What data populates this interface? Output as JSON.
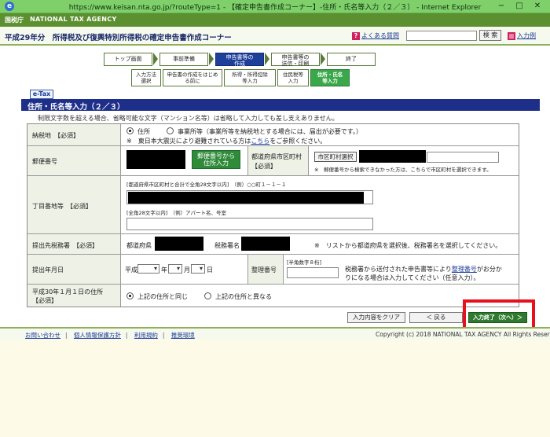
{
  "window": {
    "title": "https://www.keisan.nta.go.jp/?routeType=1 - 【確定申告書作成コーナー】-住所・氏名等入力（２／３） - Internet Explorer",
    "min": "−",
    "max": "□",
    "close": "✕"
  },
  "agency": {
    "logo": "国税庁",
    "name": "NATIONAL TAX AGENCY"
  },
  "header": {
    "page_title": "平成29年分　所得税及び復興特別所得税の確定申告書作成コーナー",
    "faq": "よくある質問",
    "search_button": "検 索",
    "example": "入力例"
  },
  "steps": {
    "main": [
      "トップ画面",
      "事前準備",
      "申告書等の",
      "作成",
      "申告書等の",
      "送信・印刷",
      "終了"
    ],
    "sub": [
      "入力方法",
      "選択",
      "申告書の作成をはじめ",
      "る前に",
      "所得・所得控除",
      "等入力",
      "住民税等",
      "入力",
      "住所・氏名",
      "等入力"
    ]
  },
  "etax_label": "e-Tax",
  "section_title": "住所・氏名等入力（２／３）",
  "note": "制限文字数を超える場合、省略可能な文字（マンション名等）は省略して入力しても差し支えありません。",
  "form": {
    "tax_place": {
      "label": "納税地",
      "required": "【必須】",
      "opt_address": "住所",
      "opt_office": "事業所等（事業所等を納税地とする場合には、届出が必要です。）",
      "disaster_note_a": "※　東日本大震災により避難されている方は",
      "disaster_link": "こちら",
      "disaster_note_b": "をご参照ください。"
    },
    "postal": {
      "label": "郵便番号",
      "convert_btn_1": "郵便番号から",
      "convert_btn_2": "住所入力",
      "pref_label": "都道府県市区町村",
      "pref_required": "【必須】",
      "city_select_btn": "市区町村選択",
      "city_note": "※　郵便番号から検索できなかった方は、こちらで市区町村を選択できます。"
    },
    "address": {
      "label": "丁目番地等",
      "required": "【必須】",
      "hint1": "[都道府県市区町村と合計で全角28文字以内]　（例）○○町１－１－１",
      "hint2": "[全角28文字以内]　（例）アパート名、号室"
    },
    "office": {
      "label": "提出先税務署",
      "required": "【必須】",
      "pref": "都道府県",
      "office_name": "税務署名",
      "note": "※　リストから都道府県を選択後、税務署名を選択してください。"
    },
    "submit_date": {
      "label": "提出年月日",
      "era": "平成",
      "year": "年",
      "month": "月",
      "day": "日",
      "ref_label": "整理番号",
      "ref_hint": "[半角数字８桁]",
      "ref_note_a": "税務署から送付された申告書等により",
      "ref_link": "整理番号",
      "ref_note_b": "がお分か",
      "ref_note_c": "りになる場合は入力してください（任意入力）。"
    },
    "jan1": {
      "label1": "平成30年１月１日の住所",
      "label2": "【必須】",
      "opt_same": "上記の住所と同じ",
      "opt_diff": "上記の住所と異なる"
    }
  },
  "actions": {
    "clear": "入力内容をクリア",
    "back": "＜ 戻る",
    "finish": "入力終了（次へ）＞"
  },
  "footer": {
    "links": [
      "お問い合わせ",
      "個人情報保護方針",
      "利用規約",
      "推奨環境"
    ],
    "copyright": "Copyright (c) 2018 NATIONAL TAX AGENCY All Rights Reserved."
  }
}
